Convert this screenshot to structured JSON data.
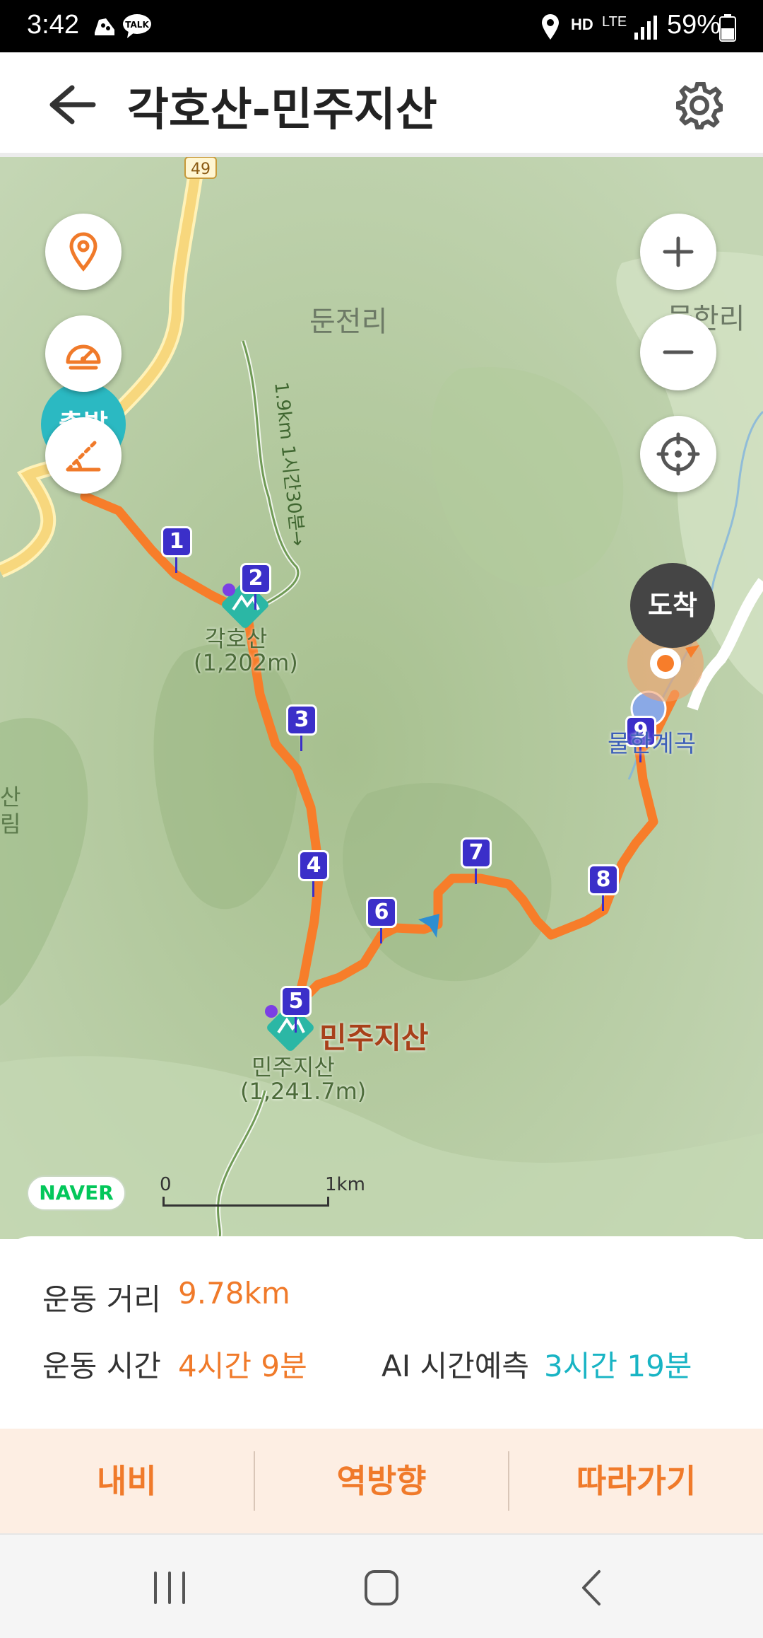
{
  "status_bar": {
    "time": "3:42",
    "battery": "59%",
    "network": "LTE",
    "hd_voice": "HD",
    "icons": [
      "shoe-icon",
      "kakaotalk-icon",
      "location-icon",
      "hd-voice-icon",
      "lte-icon",
      "signal-icon",
      "battery-icon"
    ]
  },
  "header": {
    "title": "각호산-민주지산",
    "back_icon": "arrow-left-icon",
    "settings_icon": "gear-icon"
  },
  "map": {
    "route_number": "49",
    "place_labels": {
      "village_1": "둔전리",
      "village_2": "물한리",
      "left_edge_1": "산",
      "left_edge_2": "림",
      "trail_note": "1.9km 1시간30분→",
      "peak_1_name": "각호산",
      "peak_1_elev": "(1,202m)",
      "peak_2_name": "민주지산",
      "peak_2_elev": "(1,241.7m)",
      "peak_2_big": "민주지산",
      "valley": "물한계곡"
    },
    "start_badge": "출발",
    "end_badge": "도착",
    "waypoints": [
      "1",
      "2",
      "3",
      "4",
      "5",
      "6",
      "7",
      "8",
      "9"
    ],
    "scale": {
      "zero": "0",
      "distance": "1km"
    },
    "logo": "NAVER",
    "controls": {
      "left": [
        "location-pin-icon",
        "speedometer-icon",
        "slope-icon"
      ],
      "right": [
        "zoom-in-icon",
        "zoom-out-icon",
        "crosshair-icon"
      ]
    }
  },
  "stats": {
    "distance_label": "운동 거리",
    "distance_value": "9.78km",
    "time_label": "운동 시간",
    "time_value": "4시간 9분",
    "ai_label": "AI 시간예측",
    "ai_value": "3시간 19분"
  },
  "actions": {
    "navigate": "내비",
    "reverse": "역방향",
    "follow": "따라가기"
  },
  "colors": {
    "route": "#f77d2a",
    "accent": "#f07a2a",
    "ai": "#18b4c4",
    "waypoint": "#3b2fc9",
    "peak": "#2bb7a5",
    "map_bg": "#b7cfa2"
  }
}
